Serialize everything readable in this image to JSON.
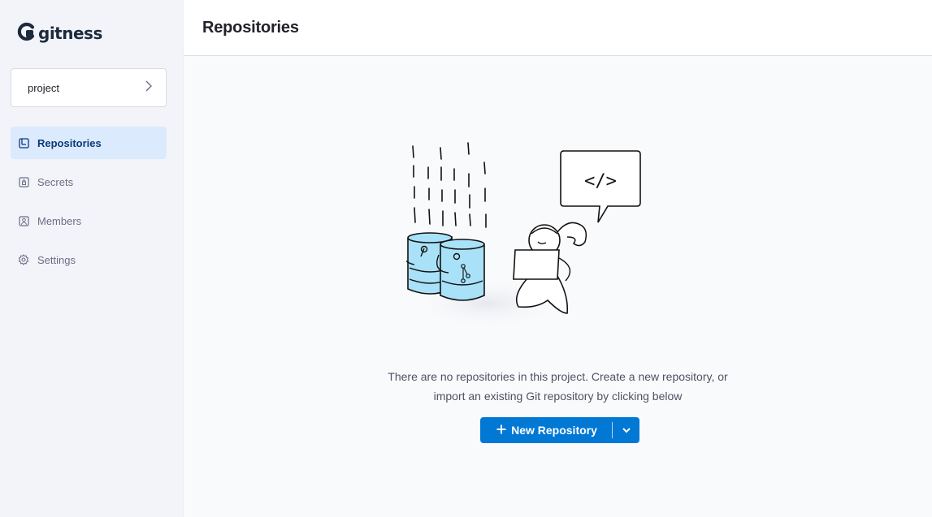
{
  "brand": {
    "name": "gitness",
    "icon": "gitness-logo-icon"
  },
  "space": {
    "name": "project",
    "icon": "chevron-right-icon"
  },
  "nav": {
    "items": [
      {
        "label": "Repositories",
        "icon": "repository-icon",
        "active": true
      },
      {
        "label": "Secrets",
        "icon": "lock-icon",
        "active": false
      },
      {
        "label": "Members",
        "icon": "person-icon",
        "active": false
      },
      {
        "label": "Settings",
        "icon": "gear-icon",
        "active": false
      }
    ]
  },
  "header": {
    "title": "Repositories"
  },
  "empty_state": {
    "illustration": "empty-repositories-illustration",
    "line1": "There are no repositories in this project. Create a new repository, or",
    "line2": "import an existing Git repository by clicking below",
    "code_bubble": "</>",
    "button_label": "New Repository",
    "button_icon": "plus-icon",
    "dropdown_icon": "chevron-down-icon"
  },
  "colors": {
    "accent": "#0278d5",
    "active_nav_bg": "#dbeafd",
    "active_nav_text": "#0b3a7a",
    "bucket_fill": "#a8e1f8"
  }
}
